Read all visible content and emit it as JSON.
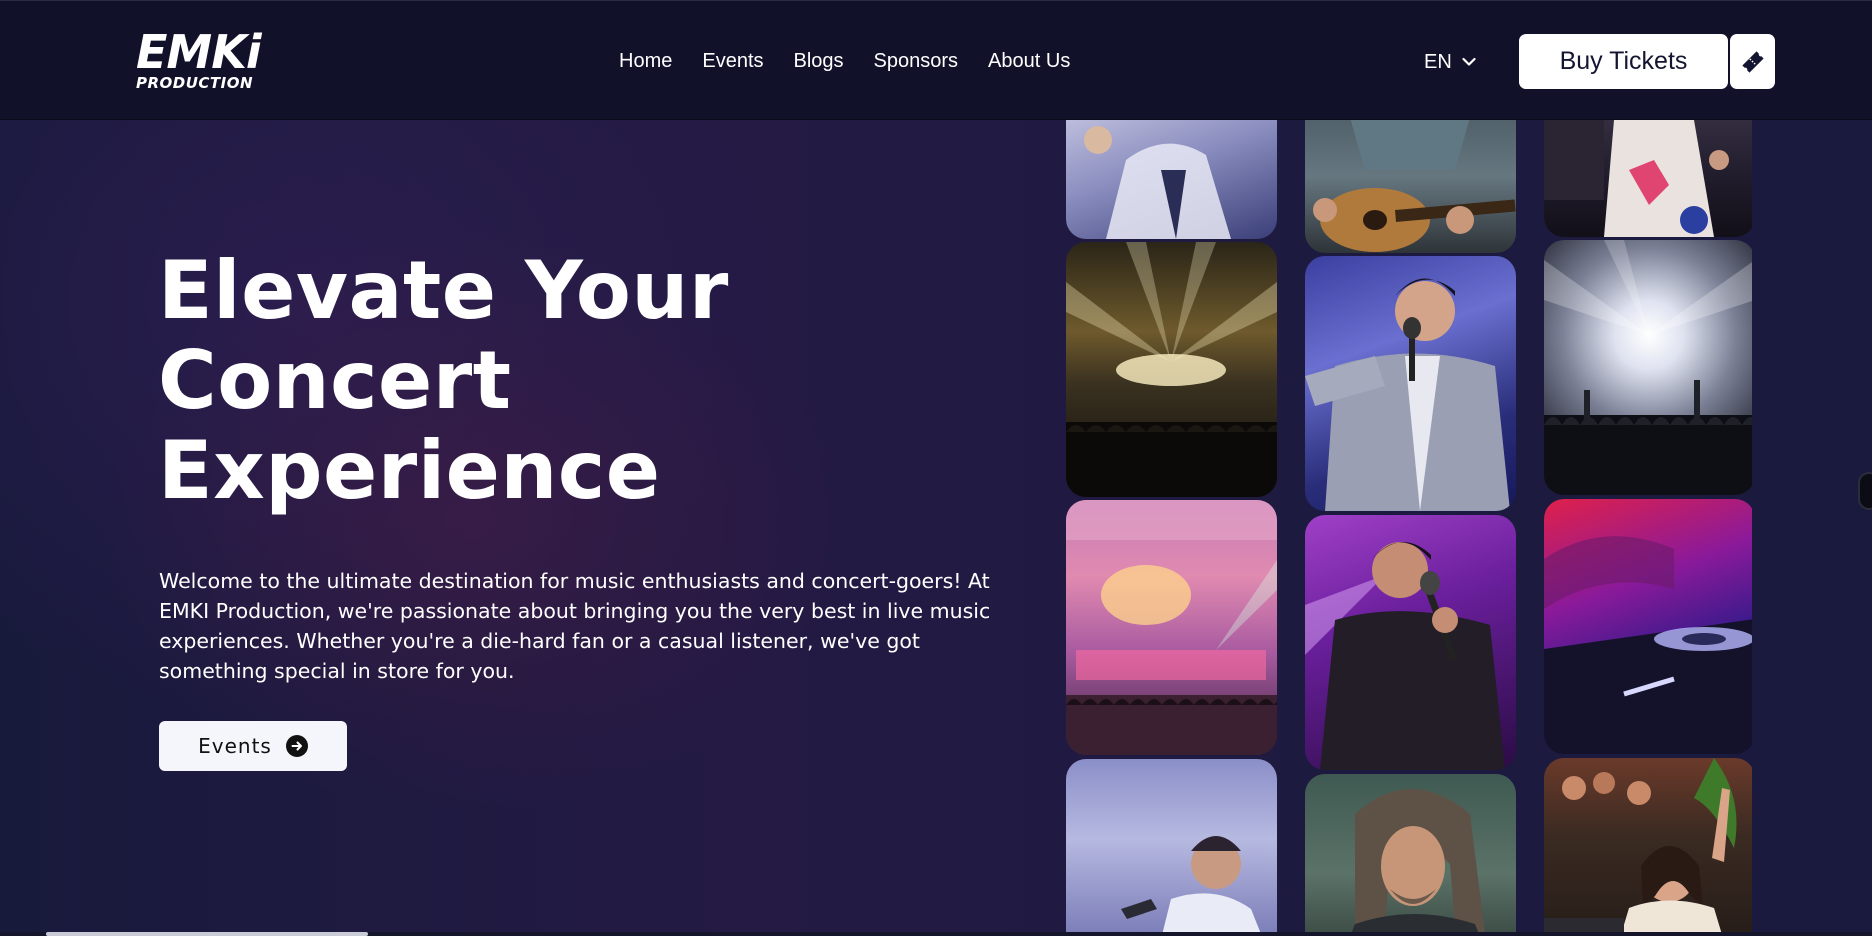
{
  "header": {
    "logo_main": "EMKi",
    "logo_sub": "PRODUCTION",
    "nav": [
      "Home",
      "Events",
      "Blogs",
      "Sponsors",
      "About Us"
    ],
    "language": "EN",
    "buy_tickets_label": "Buy Tickets"
  },
  "hero": {
    "title_lines": [
      "Elevate Your",
      "Concert",
      "Experience"
    ],
    "description": "Welcome to the ultimate destination for music enthusiasts and concert-goers! At EMKI Production, we're passionate about bringing you the very best in live music experiences. Whether you're a die-hard fan or a casual listener, we've got something special in store for you.",
    "events_button_label": "Events"
  },
  "colors": {
    "header_bg": "#11122a",
    "page_bg": "#1f1b42",
    "button_bg": "#ffffff",
    "button_text": "#141530"
  },
  "gallery": {
    "images": [
      "singer-white-jacket-photo",
      "guitarist-photo",
      "dj-booth-photo",
      "concert-stage-lights-photo",
      "singer-grey-suit-photo",
      "crowd-confetti-photo",
      "theater-stage-photo",
      "singer-purple-light-photo",
      "dj-turntable-red-photo",
      "singer-praying-photo",
      "long-hair-man-photo",
      "party-crowd-woman-photo"
    ]
  }
}
